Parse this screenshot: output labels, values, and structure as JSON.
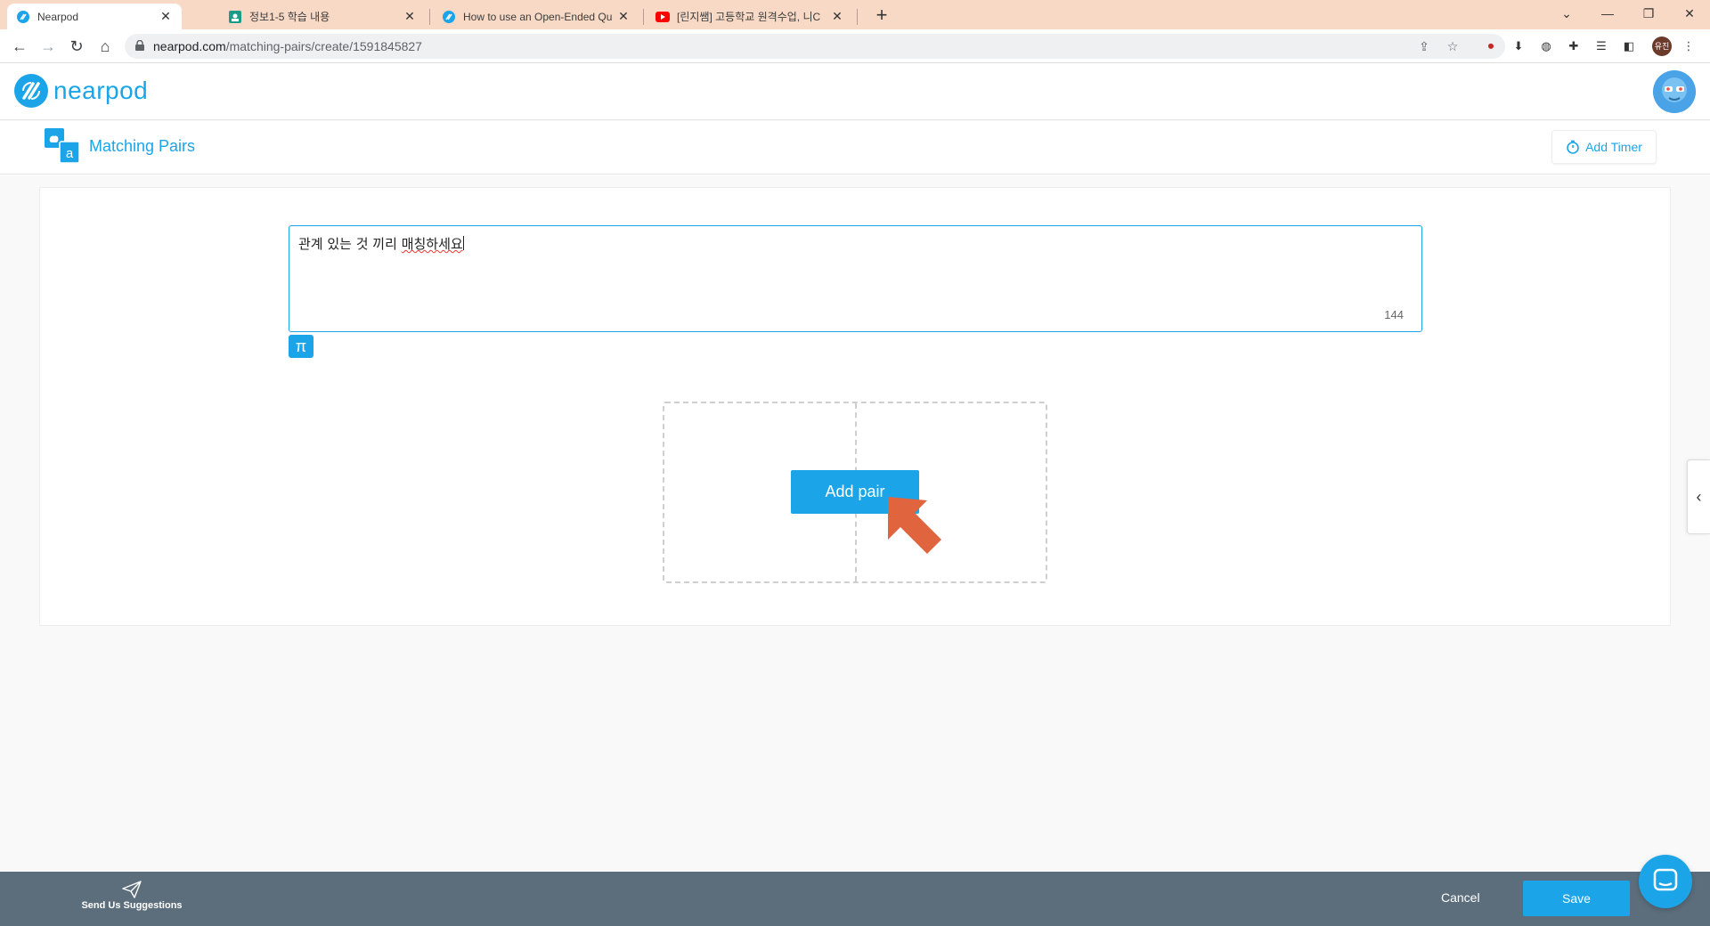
{
  "browser": {
    "tabs": [
      {
        "title": "Nearpod",
        "icon": "nearpod-favicon",
        "active": true
      },
      {
        "title": "정보1-5 학습 내용",
        "icon": "classroom-favicon",
        "active": false
      },
      {
        "title": "How to use an Open-Ended Qu",
        "icon": "nearpod-favicon",
        "active": false
      },
      {
        "title": "[린지쌤] 고등학교 원격수업, 니C",
        "icon": "youtube-favicon",
        "active": false
      }
    ],
    "new_tab_label": "+",
    "url_host": "nearpod.com",
    "url_path": "/matching-pairs/create/1591845827",
    "profile_initials": "유진"
  },
  "app": {
    "logo_text": "nearpod",
    "brand_color": "#1ba5e8"
  },
  "activity": {
    "title": "Matching Pairs",
    "timer_label": "Add Timer"
  },
  "question": {
    "text_plain": "관계 있는 것 끼리 ",
    "text_misspelled": "매칭하세요",
    "char_count": "144",
    "math_button_label": "π"
  },
  "pairs": {
    "add_pair_label": "Add pair"
  },
  "footer": {
    "suggestions_label": "Send Us Suggestions",
    "cancel_label": "Cancel",
    "save_label": "Save",
    "background_color": "#5c6e7c"
  }
}
